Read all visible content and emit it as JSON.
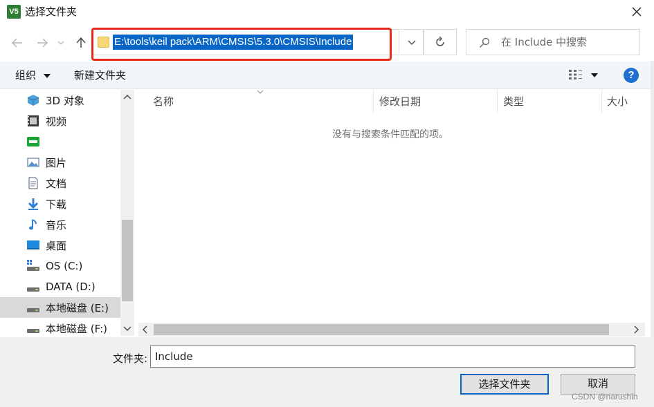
{
  "window": {
    "title": "选择文件夹",
    "app_icon_text": "V5"
  },
  "address": {
    "path": "E:\\tools\\keil pack\\ARM\\CMSIS\\5.3.0\\CMSIS\\Include"
  },
  "search": {
    "placeholder": "在 Include 中搜索"
  },
  "toolbar": {
    "organize": "组织",
    "new_folder": "新建文件夹"
  },
  "sidebar": {
    "items": [
      {
        "label": "3D 对象",
        "icon": "3d-objects-icon"
      },
      {
        "label": "视频",
        "icon": "video-icon"
      },
      {
        "label": "",
        "icon": "iqiyi-icon"
      },
      {
        "label": "图片",
        "icon": "pictures-icon"
      },
      {
        "label": "文档",
        "icon": "documents-icon"
      },
      {
        "label": "下载",
        "icon": "downloads-icon"
      },
      {
        "label": "音乐",
        "icon": "music-icon"
      },
      {
        "label": "桌面",
        "icon": "desktop-icon"
      },
      {
        "label": "OS (C:)",
        "icon": "os-drive-icon"
      },
      {
        "label": "DATA (D:)",
        "icon": "drive-icon"
      },
      {
        "label": "本地磁盘 (E:)",
        "icon": "drive-icon",
        "selected": true
      },
      {
        "label": "本地磁盘 (F:)",
        "icon": "drive-icon"
      }
    ]
  },
  "columns": {
    "name": "名称",
    "modified": "修改日期",
    "type": "类型",
    "size": "大小"
  },
  "content": {
    "empty_message": "没有与搜索条件匹配的项。"
  },
  "bottom": {
    "folder_label": "文件夹:",
    "folder_value": "Include",
    "select_button": "选择文件夹",
    "cancel_button": "取消"
  },
  "watermark": "CSDN @narushin",
  "colors": {
    "accent": "#0a66c6",
    "highlight": "#e8281d",
    "selection": "#d9d9d9"
  }
}
